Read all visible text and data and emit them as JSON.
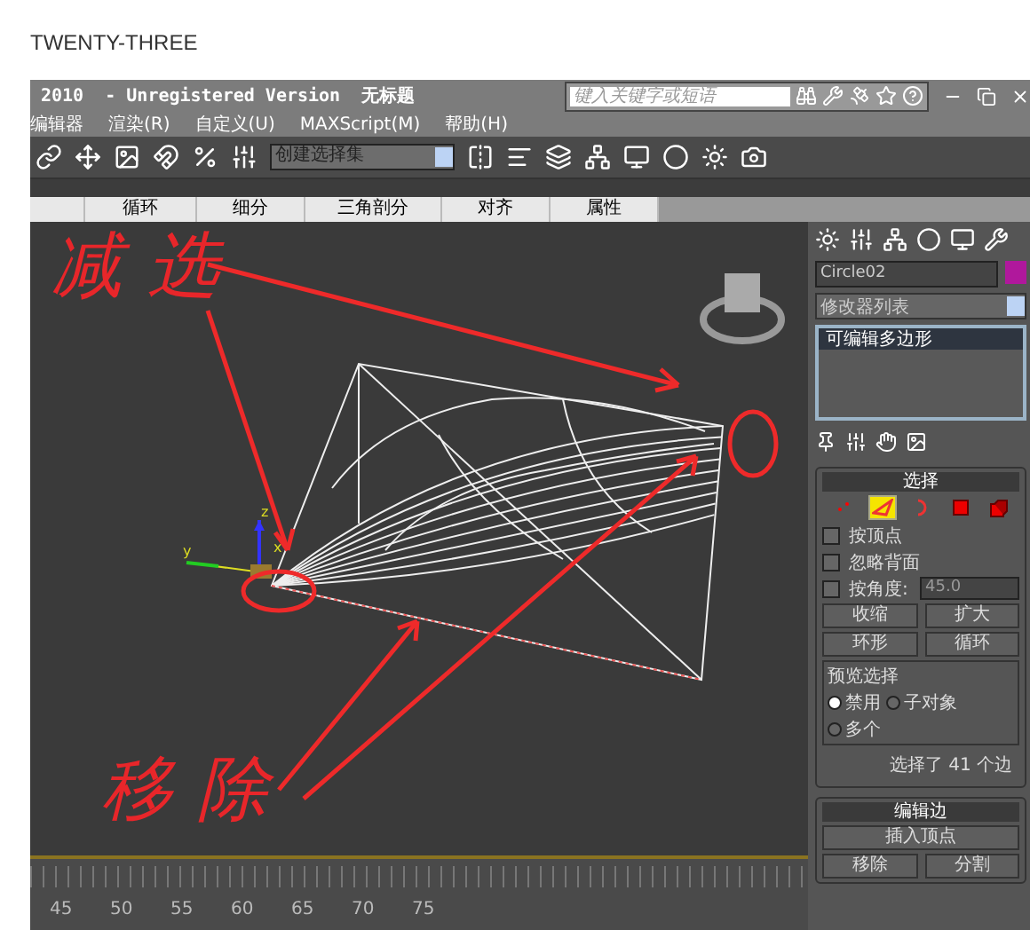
{
  "page_heading": "TWENTY-THREE",
  "window": {
    "title": "2010  - Unregistered Version  无标题",
    "search_placeholder": "键入关键字或短语"
  },
  "menu": [
    "编辑器",
    "渲染(R)",
    "自定义(U)",
    "MAXScript(M)",
    "帮助(H)"
  ],
  "toolbar": {
    "selection_set": "创建选择集"
  },
  "ribbon_tabs": [
    "循环",
    "细分",
    "三角剖分",
    "对齐",
    "属性"
  ],
  "viewport": {
    "annotations": [
      {
        "text": "减选",
        "kind": "top"
      },
      {
        "text": "移除",
        "kind": "bottom"
      }
    ],
    "axis_labels": [
      "y",
      "z",
      "x"
    ]
  },
  "timeline": {
    "ticks": [
      "45",
      "50",
      "55",
      "60",
      "65",
      "70",
      "75"
    ]
  },
  "command_panel": {
    "object": {
      "name": "Circle02",
      "color": "#b0189c"
    },
    "modifier_list": "修改器列表",
    "stack": [
      {
        "label": "可编辑多边形",
        "selected": true
      }
    ],
    "selection": {
      "title": "选择",
      "levels": [
        {
          "kind": "vertex",
          "selected": false
        },
        {
          "kind": "edge",
          "selected": true
        },
        {
          "kind": "border",
          "selected": false
        },
        {
          "kind": "polygon",
          "selected": false
        },
        {
          "kind": "element",
          "selected": false
        }
      ],
      "options": [
        {
          "label": "按顶点",
          "checked": false
        },
        {
          "label": "忽略背面",
          "checked": false
        },
        {
          "label": "按角度:",
          "checked": false,
          "value": "45.0"
        }
      ],
      "buttons": [
        "收缩",
        "扩大"
      ],
      "spinner_buttons": [
        "环形",
        "循环"
      ],
      "preview": {
        "title": "预览选择",
        "options": [
          {
            "label": "禁用",
            "selected": true
          },
          {
            "label": "子对象",
            "selected": false
          },
          {
            "label": "多个",
            "selected": false
          }
        ]
      },
      "status": "选择了 41 个边"
    },
    "edit_edges": {
      "title": "编辑边",
      "buttons": [
        "插入顶点"
      ],
      "pair": [
        "移除",
        "分割"
      ]
    }
  }
}
